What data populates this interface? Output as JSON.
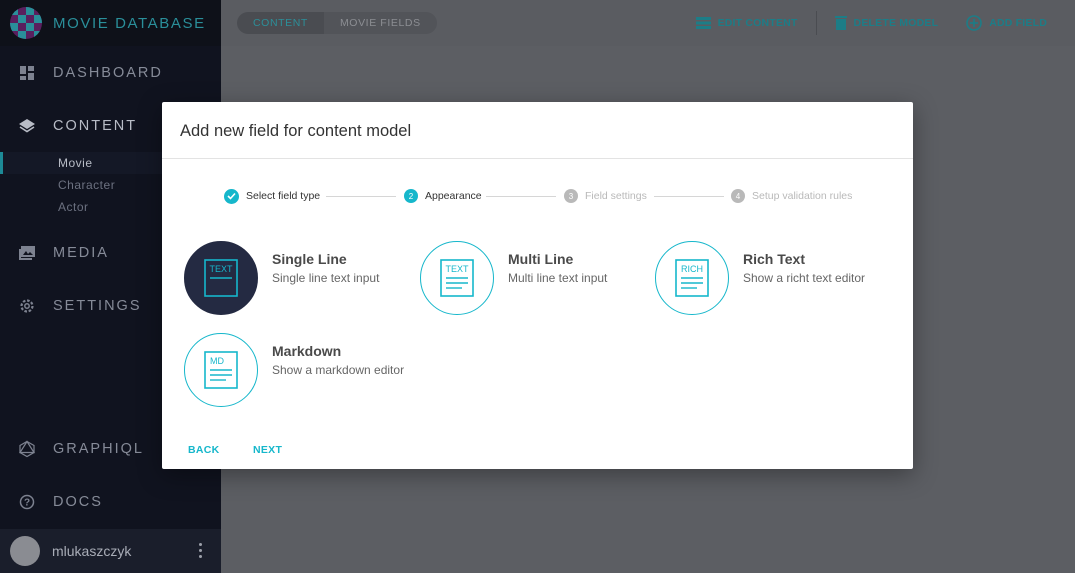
{
  "app": {
    "title": "MOVIE DATABASE"
  },
  "sidebar": {
    "items": [
      {
        "label": "DASHBOARD",
        "icon": "dashboard-icon"
      },
      {
        "label": "CONTENT",
        "icon": "layers-icon"
      },
      {
        "label": "MEDIA",
        "icon": "image-icon"
      },
      {
        "label": "SETTINGS",
        "icon": "gear-icon"
      },
      {
        "label": "GRAPHIQL",
        "icon": "graphql-icon"
      },
      {
        "label": "DOCS",
        "icon": "help-icon"
      }
    ],
    "sub_items": [
      "Movie",
      "Character",
      "Actor"
    ],
    "user": {
      "name": "mlukaszczyk"
    }
  },
  "topbar": {
    "breadcrumbs": [
      "CONTENT",
      "MOVIE FIELDS"
    ],
    "actions": [
      {
        "label": "EDIT CONTENT",
        "icon": "list-icon"
      },
      {
        "label": "DELETE MODEL",
        "icon": "trash-icon"
      },
      {
        "label": "ADD FIELD",
        "icon": "add-circle-icon"
      }
    ]
  },
  "modal": {
    "title": "Add new field for content model",
    "steps": [
      {
        "number": "1",
        "label": "Select field type",
        "state": "done"
      },
      {
        "number": "2",
        "label": "Appearance",
        "state": "current"
      },
      {
        "number": "3",
        "label": "Field settings",
        "state": "todo"
      },
      {
        "number": "4",
        "label": "Setup validation rules",
        "state": "todo"
      }
    ],
    "options": [
      {
        "badge": "TEXT",
        "title": "Single Line",
        "description": "Single line text input",
        "selected": true
      },
      {
        "badge": "TEXT",
        "title": "Multi Line",
        "description": "Multi line text input",
        "selected": false
      },
      {
        "badge": "RICH",
        "title": "Rich Text",
        "description": "Show a richt text editor",
        "selected": false
      },
      {
        "badge": "MD",
        "title": "Markdown",
        "description": "Show a markdown editor",
        "selected": false
      }
    ],
    "back_label": "BACK",
    "next_label": "NEXT"
  },
  "colors": {
    "accent": "#16b7cb",
    "sidebar_bg": "#10131f",
    "selected_option": "#242a42"
  }
}
